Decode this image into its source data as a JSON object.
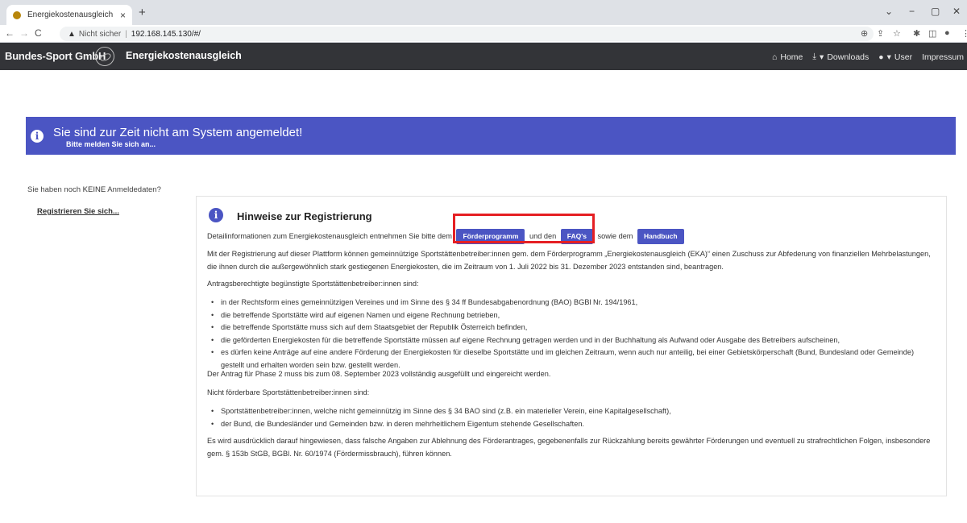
{
  "browser": {
    "tab_title": "Energiekostenausgleich",
    "tab_close": "×",
    "new_tab": "+",
    "security_label": "Nicht sicher",
    "url": "192.168.145.130/#/",
    "win_min": "−",
    "win_max": "▢",
    "win_close": "✕",
    "tab_search": "⌄"
  },
  "navbar": {
    "brand": "Bundes-Sport GmbH",
    "app_title": "Energiekostenausgleich",
    "home": "Home",
    "downloads": "Downloads",
    "user": "User",
    "impressum": "Impressum"
  },
  "alert": {
    "title": "Sie sind zur Zeit nicht am System angemeldet!",
    "subtitle": "Bitte melden Sie sich an..."
  },
  "sidebar": {
    "no_data_prefix": "Sie haben noch ",
    "no_data_bold": "KEINE",
    "no_data_suffix": " Anmeldedaten?",
    "register_link": "Registrieren Sie sich..."
  },
  "panel": {
    "title": "Hinweise zur Registrierung",
    "intro_a": "Detailinformationen zum Energiekostenausgleich entnehmen Sie bitte dem",
    "btn_foerder": "Förderprogramm",
    "intro_b": "und den",
    "btn_faq": "FAQ's",
    "intro_c": "sowie dem",
    "btn_handbuch": "Handbuch",
    "p1": "Mit der Registrierung auf dieser Plattform können gemeinnützige Sportstättenbetreiber:innen gem. dem Förderprogramm „Energiekostenausgleich (EKA)“ einen Zuschuss zur Abfederung von finanziellen Mehrbelastungen, die ihnen durch die außergewöhnlich stark gestiegenen Energiekosten, die im Zeitraum von 1. Juli 2022 bis 31. Dezember 2023 entstanden sind, beantragen.",
    "p2": "Antragsberechtigte begünstigte Sportstättenbetreiber:innen sind:",
    "list1": [
      "in der Rechtsform eines gemeinnützigen Vereines und im Sinne des § 34 ff Bundesabgabenordnung (BAO) BGBl Nr. 194/1961,",
      "die betreffende Sportstätte wird auf eigenen Namen und eigene Rechnung betrieben,",
      "die betreffende Sportstätte muss sich auf dem Staatsgebiet der Republik Österreich befinden,",
      "die geförderten Energiekosten für die betreffende Sportstätte müssen auf eigene Rechnung getragen werden und in der Buchhaltung als Aufwand oder Ausgabe des Betreibers aufscheinen,",
      "es dürfen keine Anträge auf eine andere Förderung der Energiekosten für dieselbe Sportstätte und im gleichen Zeitraum, wenn auch nur anteilig, bei einer Gebietskörperschaft (Bund, Bundesland oder Gemeinde) gestellt und erhalten worden sein bzw. gestellt werden."
    ],
    "p3": "Der Antrag für Phase 2 muss bis zum 08. September 2023 vollständig ausgefüllt und eingereicht werden.",
    "p4": "Nicht förderbare Sportstättenbetreiber:innen sind:",
    "list2": [
      "Sportstättenbetreiber:innen, welche nicht gemeinnützig im Sinne des § 34 BAO sind (z.B. ein materieller Verein, eine Kapitalgesellschaft),",
      "der Bund, die Bundesländer und Gemeinden bzw. in deren mehrheitlichem Eigentum stehende Gesellschaften."
    ],
    "p5": "Es wird ausdrücklich darauf hingewiesen, dass falsche Angaben zur Ablehnung des Förderantrages, gegebenenfalls zur Rückzahlung bereits gewährter Förderungen und eventuell zu strafrechtlichen Folgen, insbesondere gem. § 153b StGB, BGBl. Nr. 60/1974 (Fördermissbrauch), führen können."
  },
  "colors": {
    "accent": "#4b55c3",
    "navbar": "#333438",
    "highlight": "#e51f23"
  }
}
